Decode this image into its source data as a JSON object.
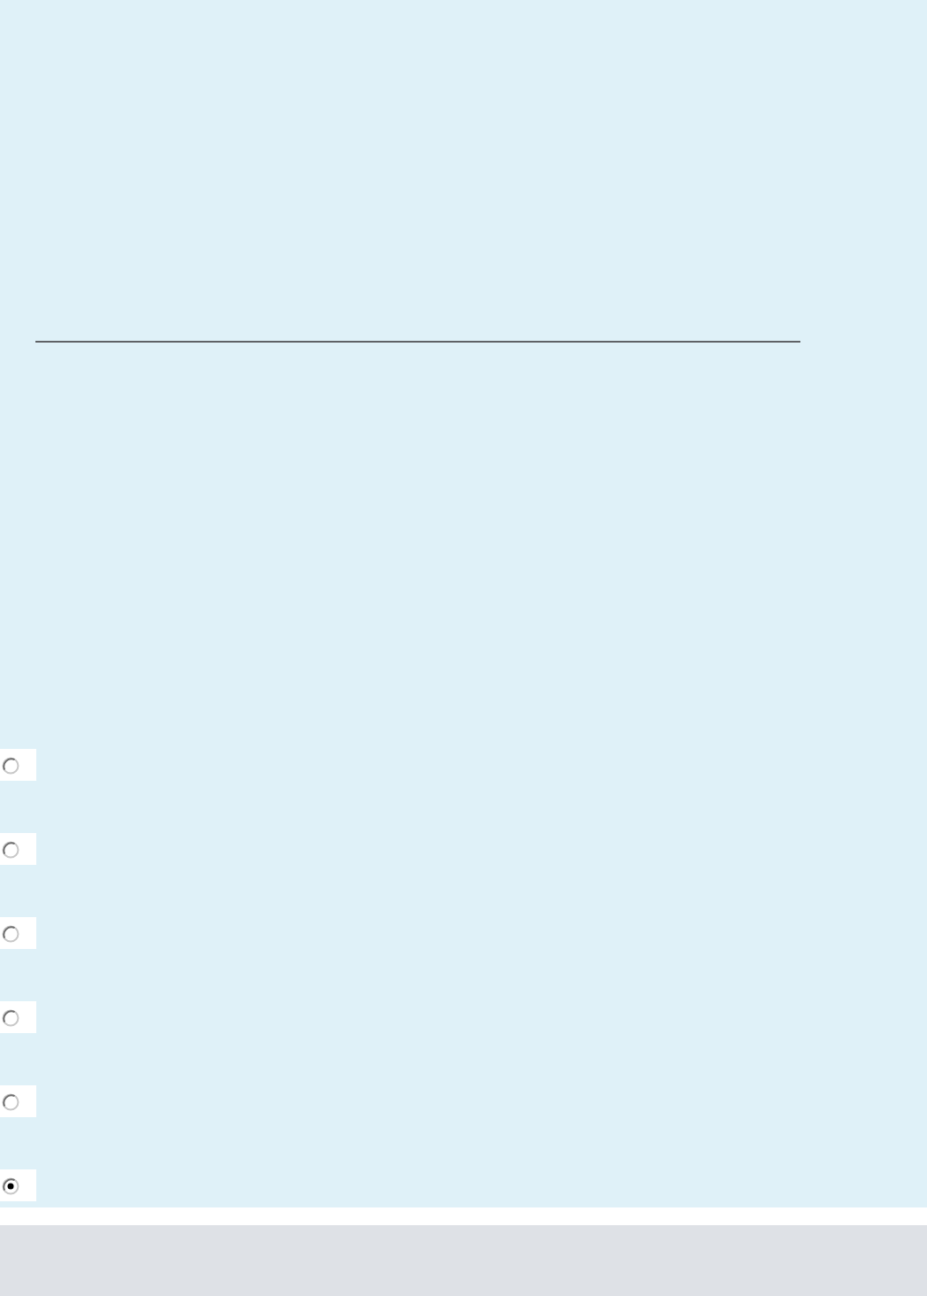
{
  "options": [
    {
      "selected": false
    },
    {
      "selected": false
    },
    {
      "selected": false
    },
    {
      "selected": false
    },
    {
      "selected": false
    },
    {
      "selected": true
    }
  ]
}
